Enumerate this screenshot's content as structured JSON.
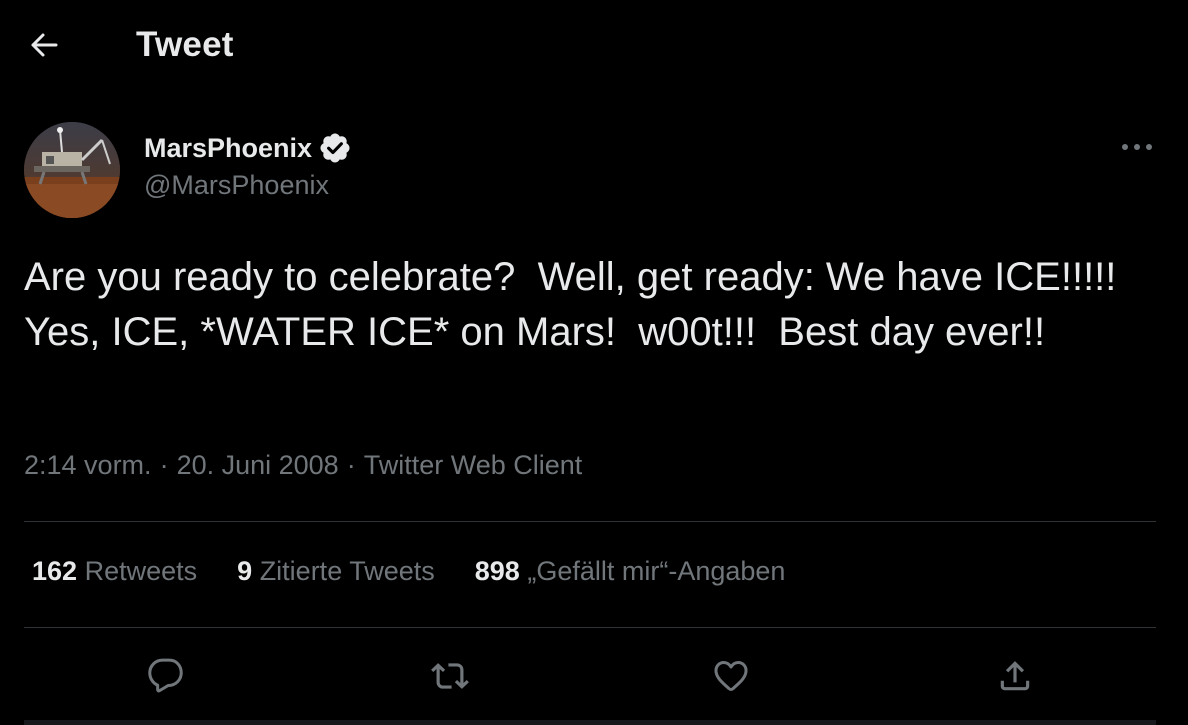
{
  "header": {
    "title": "Tweet",
    "back_icon": "back-arrow-icon"
  },
  "author": {
    "name": "MarsPhoenix",
    "handle": "@MarsPhoenix",
    "verified": true,
    "verified_icon": "verified-badge-icon",
    "more_icon": "more-dots-icon"
  },
  "tweet": {
    "text": "Are you ready to celebrate?  Well, get ready: We have ICE!!!!! Yes, ICE, *WATER ICE* on Mars!  w00t!!!  Best day ever!!",
    "time": "2:14 vorm.",
    "date": "20. Juni 2008",
    "client": "Twitter Web Client",
    "separator": "·"
  },
  "stats": {
    "retweets": {
      "count": "162",
      "label": "Retweets"
    },
    "quotes": {
      "count": "9",
      "label": "Zitierte Tweets"
    },
    "likes": {
      "count": "898",
      "label": "„Gefällt mir“-Angaben"
    }
  },
  "actions": [
    "reply-icon",
    "retweet-icon",
    "like-icon",
    "share-icon"
  ],
  "colors": {
    "background": "#000000",
    "text_primary": "#e7e9ea",
    "text_secondary": "#71767b",
    "divider": "#2f3336"
  }
}
